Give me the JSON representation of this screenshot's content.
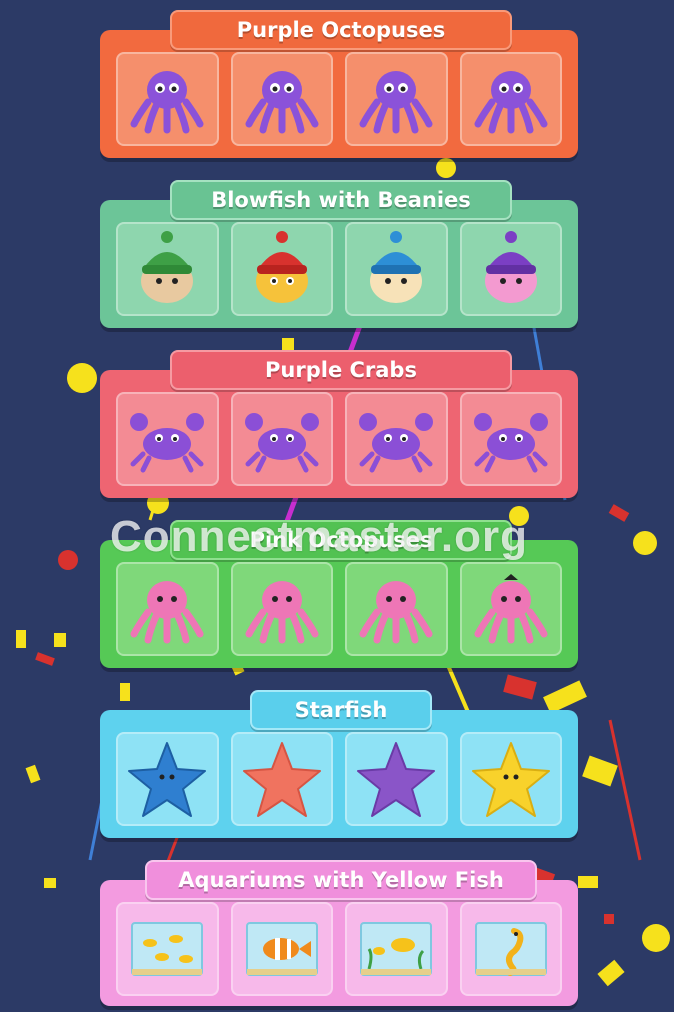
{
  "groups": [
    {
      "title": "Purple Octopuses",
      "color": "#f26a3f",
      "title_color": "#f0693d",
      "tile_color": "#f58f6c",
      "items": [
        {
          "icon": "octopus-icon",
          "color": "#8b52d9"
        },
        {
          "icon": "octopus-icon",
          "color": "#8b52d9"
        },
        {
          "icon": "octopus-icon",
          "color": "#8b52d9"
        },
        {
          "icon": "octopus-icon",
          "color": "#8b52d9"
        }
      ]
    },
    {
      "title": "Blowfish with Beanies",
      "color": "#6cc598",
      "title_color": "#69c393",
      "tile_color": "#8ed6ae",
      "items": [
        {
          "icon": "blowfish-green-beanie-icon",
          "color": "#3ea046"
        },
        {
          "icon": "blowfish-red-beanie-icon",
          "color": "#d8322e"
        },
        {
          "icon": "blowfish-blue-beanie-icon",
          "color": "#2d8fd6"
        },
        {
          "icon": "blowfish-purple-beanie-icon",
          "color": "#7b3fc4"
        }
      ]
    },
    {
      "title": "Purple Crabs",
      "color": "#ee6572",
      "title_color": "#ec5f6d",
      "tile_color": "#f38b94",
      "items": [
        {
          "icon": "crab-icon",
          "color": "#8b4fd6"
        },
        {
          "icon": "crab-icon",
          "color": "#8b4fd6"
        },
        {
          "icon": "crab-icon",
          "color": "#8b4fd6"
        },
        {
          "icon": "crab-icon",
          "color": "#8b4fd6"
        }
      ]
    },
    {
      "title": "Pink Octopuses",
      "color": "#56c956",
      "title_color": "#52c252",
      "tile_color": "#7fd87a",
      "items": [
        {
          "icon": "octopus-icon",
          "color": "#ee76b6"
        },
        {
          "icon": "octopus-icon",
          "color": "#ee76b6"
        },
        {
          "icon": "octopus-icon",
          "color": "#ee76b6"
        },
        {
          "icon": "octopus-icon",
          "color": "#ee76b6"
        }
      ]
    },
    {
      "title": "Starfish",
      "color": "#5ed2ee",
      "title_color": "#5acfec",
      "tile_color": "#8ee2f5",
      "items": [
        {
          "icon": "starfish-blue-icon",
          "color": "#2f7fd0"
        },
        {
          "icon": "starfish-coral-icon",
          "color": "#f0735f"
        },
        {
          "icon": "starfish-purple-icon",
          "color": "#8a55c8"
        },
        {
          "icon": "starfish-yellow-icon",
          "color": "#f8d22b"
        }
      ]
    },
    {
      "title": "Aquariums with Yellow Fish",
      "color": "#f39be0",
      "title_color": "#f08fdc",
      "tile_color": "#f7b9ea",
      "items": [
        {
          "icon": "aquarium-icon",
          "color": "#f6c21a"
        },
        {
          "icon": "aquarium-clownfish-icon",
          "color": "#f08a1c"
        },
        {
          "icon": "aquarium-icon",
          "color": "#f6c21a"
        },
        {
          "icon": "aquarium-seahorse-icon",
          "color": "#f2b21a"
        }
      ]
    }
  ],
  "watermark": "Connectmaster.org"
}
